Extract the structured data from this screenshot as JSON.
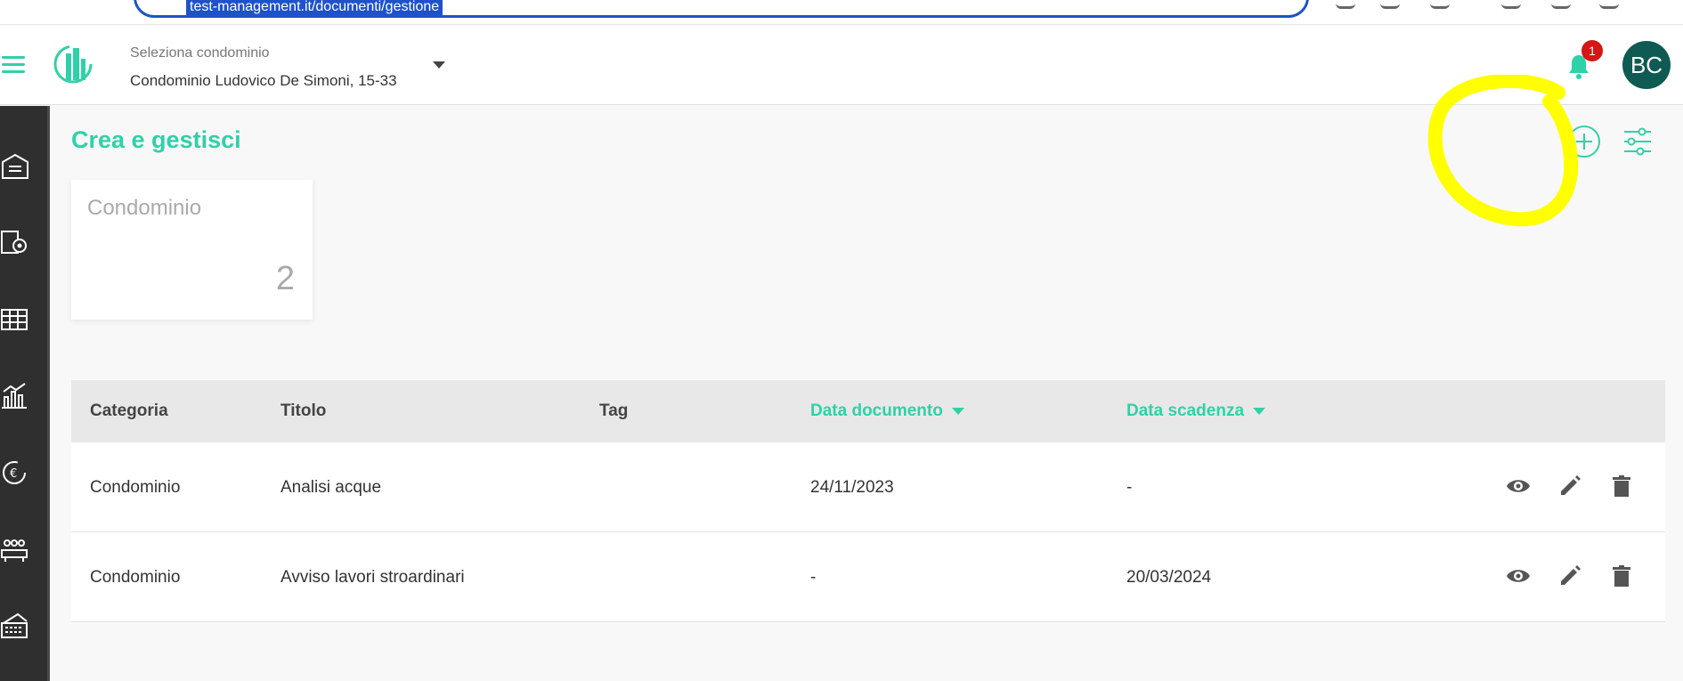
{
  "browser": {
    "address_text": "test-management.it/documenti/gestione"
  },
  "header": {
    "selector_label": "Seleziona condominio",
    "selected_condominio": "Condominio Ludovico De Simoni, 15-33",
    "notification_count": "1",
    "user_initials": "BC"
  },
  "sidebar": {
    "items": [
      "home-icon",
      "documents-settings-icon",
      "table-icon",
      "chart-icon",
      "euro-cycle-icon",
      "people-meeting-icon",
      "keyboard-icon"
    ]
  },
  "main": {
    "title": "Crea e gestisci",
    "card": {
      "title": "Condominio",
      "count": "2"
    },
    "table": {
      "columns": [
        "Categoria",
        "Titolo",
        "Tag",
        "Data documento",
        "Data scadenza"
      ],
      "rows": [
        {
          "categoria": "Condominio",
          "titolo": "Analisi acque",
          "tag": "",
          "data_documento": "24/11/2023",
          "data_scadenza": "-"
        },
        {
          "categoria": "Condominio",
          "titolo": "Avviso lavori stroardinari",
          "tag": "",
          "data_documento": "-",
          "data_scadenza": "20/03/2024"
        }
      ]
    }
  },
  "colors": {
    "accent": "#2fd1a8",
    "sidebar": "#2f2f2f",
    "avatar": "#0f5a52",
    "badge": "#d61515",
    "highlight": "#ffff00"
  }
}
